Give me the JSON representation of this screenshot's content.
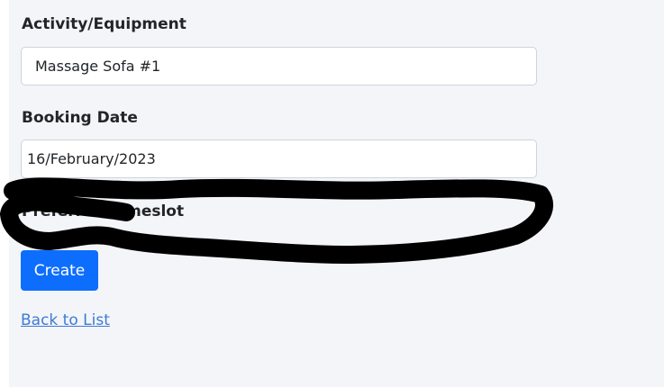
{
  "form": {
    "activity_label": "Activity/Equipment",
    "activity_value": "Massage Sofa #1",
    "booking_date_label": "Booking Date",
    "booking_date_value": "16/February/2023",
    "timeslot_label": "Preferred Timeslot",
    "create_button_label": "Create"
  },
  "links": {
    "back_to_list": "Back to List"
  },
  "colors": {
    "page_background": "#f4f5f9",
    "primary_button": "#0d6efd",
    "link": "#3c7bd6",
    "redaction_scribble": "#000000"
  }
}
